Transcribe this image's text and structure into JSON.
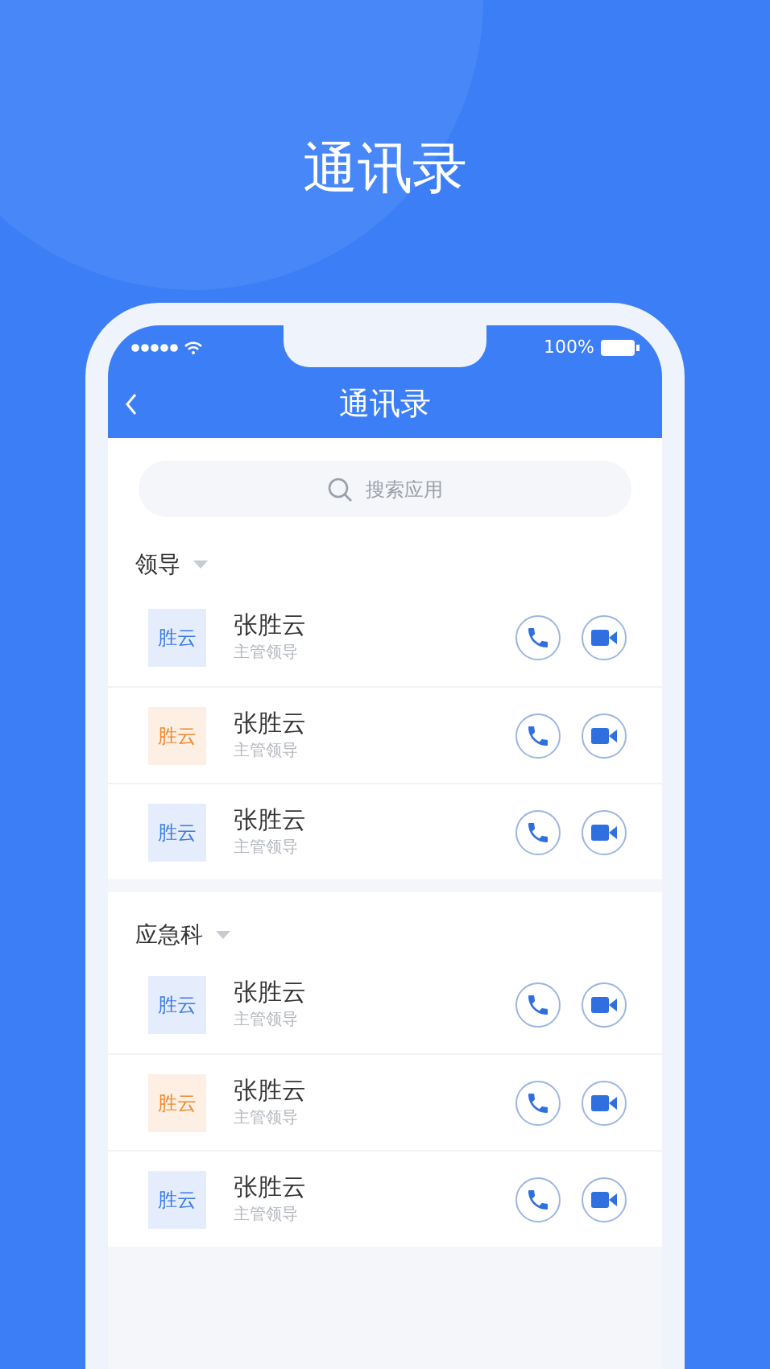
{
  "headline": "通讯录",
  "status_bar": {
    "battery": "100%"
  },
  "nav": {
    "title": "通讯录"
  },
  "search": {
    "placeholder": "搜索应用"
  },
  "groups": [
    {
      "name": "领导",
      "contacts": [
        {
          "avatar_text": "胜云",
          "color": "#3a7be6",
          "name": "张胜云",
          "role": "主管领导"
        },
        {
          "avatar_text": "胜云",
          "color": "#ee8a2e",
          "name": "张胜云",
          "role": "主管领导"
        },
        {
          "avatar_text": "胜云",
          "color": "#3a7be6",
          "name": "张胜云",
          "role": "主管领导"
        }
      ]
    },
    {
      "name": "应急科",
      "contacts": [
        {
          "avatar_text": "胜云",
          "color": "#3a7be6",
          "name": "张胜云",
          "role": "主管领导"
        },
        {
          "avatar_text": "胜云",
          "color": "#ee8a2e",
          "name": "张胜云",
          "role": "主管领导"
        },
        {
          "avatar_text": "胜云",
          "color": "#3a7be6",
          "name": "张胜云",
          "role": "主管领导"
        }
      ]
    }
  ]
}
